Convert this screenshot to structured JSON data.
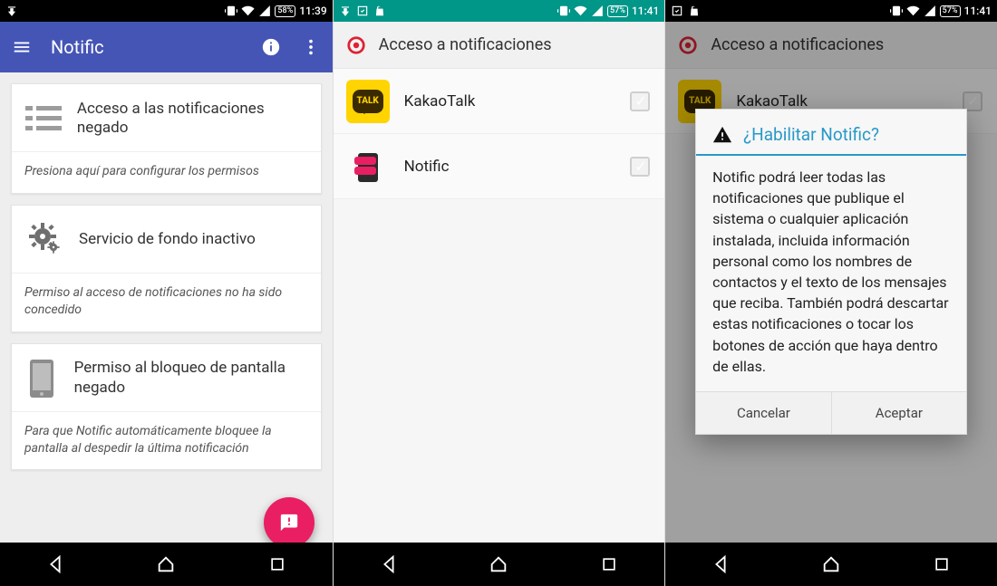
{
  "screens": [
    {
      "status": {
        "battery": "58%",
        "time": "11:39"
      },
      "appbar": {
        "title": "Notific"
      },
      "cards": [
        {
          "icon": "list-icon",
          "title": "Acceso a las notificaciones negado",
          "subtitle": "Presiona aquí para configurar los permisos"
        },
        {
          "icon": "gears-icon",
          "title": "Servicio de fondo inactivo",
          "subtitle": "Permiso al acceso de notificaciones no ha sido concedido"
        },
        {
          "icon": "phone-icon",
          "title": "Permiso al bloqueo de pantalla negado",
          "subtitle": "Para que Notific automáticamente bloquee la pantalla al despedir la última notificación"
        }
      ]
    },
    {
      "status": {
        "battery": "57%",
        "time": "11:41"
      },
      "header": "Acceso a notificaciones",
      "rows": [
        {
          "icon": "kakao",
          "label": "KakaoTalk",
          "checked": false
        },
        {
          "icon": "notific",
          "label": "Notific",
          "checked": false
        }
      ]
    },
    {
      "status": {
        "battery": "57%",
        "time": "11:41"
      },
      "header": "Acceso a notificaciones",
      "rows": [
        {
          "icon": "kakao",
          "label": "KakaoTalk",
          "checked": false
        }
      ],
      "dialog": {
        "title": "¿Habilitar Notific?",
        "body": "Notific podrá leer todas las notificaciones que publique el sistema o cualquier aplicación instalada, incluida información personal como los nombres de contactos y el texto de los mensajes que reciba. También podrá descartar estas notificaciones o tocar los botones de acción que haya dentro de ellas.",
        "cancel": "Cancelar",
        "accept": "Aceptar"
      }
    }
  ],
  "kakao_bubble_text": "TALK"
}
